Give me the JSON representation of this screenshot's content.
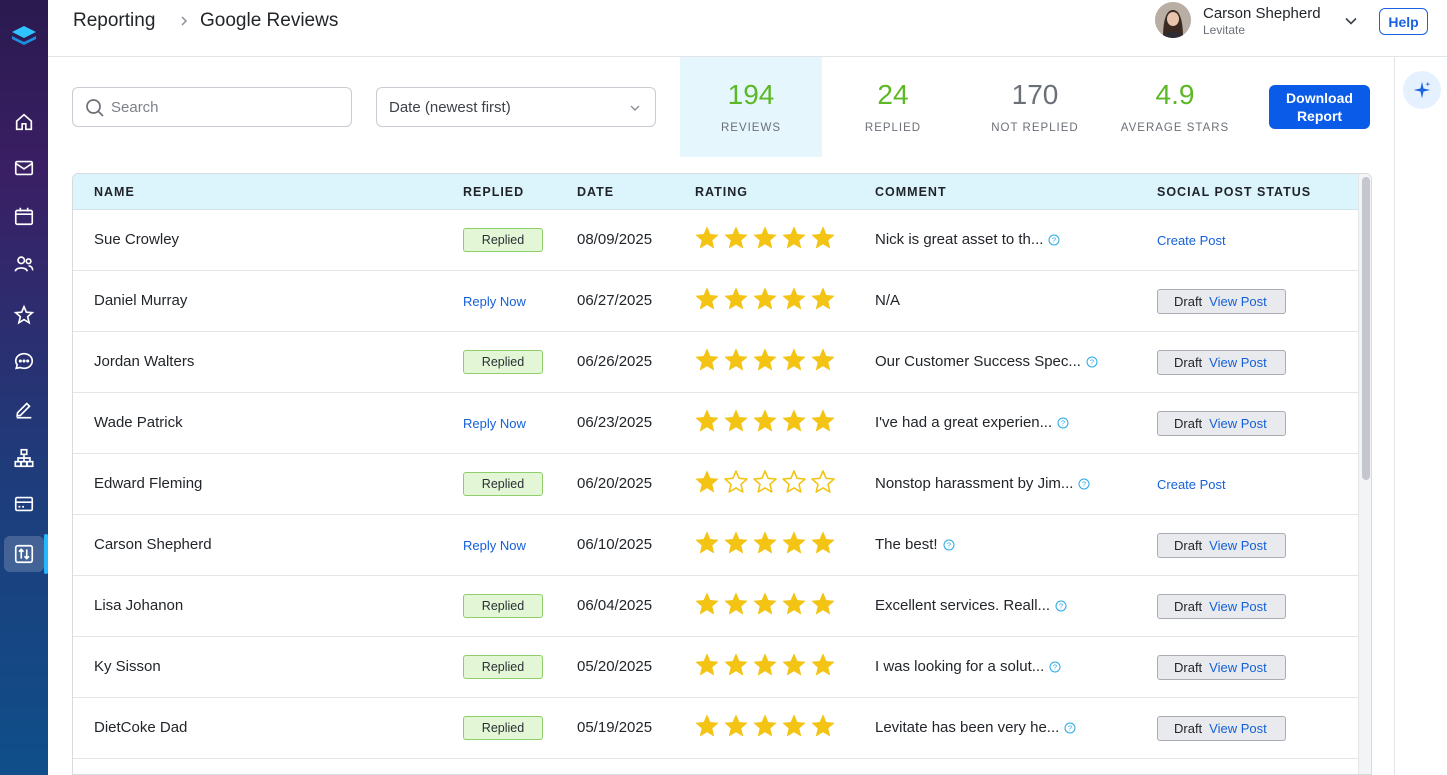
{
  "header": {
    "breadcrumb": [
      "Reporting",
      "Google Reviews"
    ],
    "user_name": "Carson Shepherd",
    "user_org": "Levitate",
    "help_label": "Help"
  },
  "sidebar": {
    "items": [
      {
        "icon": "home-icon"
      },
      {
        "icon": "mail-icon"
      },
      {
        "icon": "calendar-icon"
      },
      {
        "icon": "contacts-icon"
      },
      {
        "icon": "star-icon"
      },
      {
        "icon": "chat-icon"
      },
      {
        "icon": "edit-icon"
      },
      {
        "icon": "sitemap-icon"
      },
      {
        "icon": "billing-icon"
      },
      {
        "icon": "reporting-icon",
        "active": true
      }
    ]
  },
  "toolbar": {
    "search_placeholder": "Search",
    "sort_value": "Date (newest first)",
    "download_label_line1": "Download",
    "download_label_line2": "Report"
  },
  "stats": [
    {
      "value": "194",
      "label": "REVIEWS",
      "color": "#5cb825"
    },
    {
      "value": "24",
      "label": "REPLIED",
      "color": "#5cb825"
    },
    {
      "value": "170",
      "label": "NOT REPLIED",
      "color": "#6b7078"
    },
    {
      "value": "4.9",
      "label": "AVERAGE STARS",
      "color": "#5cb825"
    }
  ],
  "table": {
    "columns": [
      "NAME",
      "REPLIED",
      "DATE",
      "RATING",
      "COMMENT",
      "SOCIAL POST STATUS"
    ],
    "rows": [
      {
        "name": "Sue Crowley",
        "replied": true,
        "date": "08/09/2025",
        "rating": 5,
        "comment": "Nick is great asset to th...",
        "has_info": true,
        "post_status": "create"
      },
      {
        "name": "Daniel Murray",
        "replied": false,
        "date": "06/27/2025",
        "rating": 5,
        "comment": "N/A",
        "has_info": false,
        "post_status": "draft"
      },
      {
        "name": "Jordan Walters",
        "replied": true,
        "date": "06/26/2025",
        "rating": 5,
        "comment": "Our Customer Success Spec...",
        "has_info": true,
        "post_status": "draft"
      },
      {
        "name": "Wade Patrick",
        "replied": false,
        "date": "06/23/2025",
        "rating": 5,
        "comment": "I've had a great experien...",
        "has_info": true,
        "post_status": "draft"
      },
      {
        "name": "Edward Fleming",
        "replied": true,
        "date": "06/20/2025",
        "rating": 1,
        "comment": "Nonstop harassment by Jim...",
        "has_info": true,
        "post_status": "create"
      },
      {
        "name": "Carson Shepherd",
        "replied": false,
        "date": "06/10/2025",
        "rating": 5,
        "comment": "The best!",
        "has_info": true,
        "post_status": "draft"
      },
      {
        "name": "Lisa Johanon",
        "replied": true,
        "date": "06/04/2025",
        "rating": 5,
        "comment": "Excellent services. Reall...",
        "has_info": true,
        "post_status": "draft"
      },
      {
        "name": "Ky Sisson",
        "replied": true,
        "date": "05/20/2025",
        "rating": 5,
        "comment": "I was looking for a solut...",
        "has_info": true,
        "post_status": "draft"
      },
      {
        "name": "DietCoke Dad",
        "replied": true,
        "date": "05/19/2025",
        "rating": 5,
        "comment": "Levitate has been very he...",
        "has_info": true,
        "post_status": "draft"
      }
    ],
    "labels": {
      "replied": "Replied",
      "reply_now": "Reply Now",
      "create_post": "Create Post",
      "draft": "Draft",
      "view_post": "View Post"
    }
  },
  "colors": {
    "accent_blue": "#0a5be8",
    "link_blue": "#1560d8",
    "star_gold": "#f3c414",
    "success_green": "#5cb825",
    "header_row_bg": "#dcf4fc"
  }
}
